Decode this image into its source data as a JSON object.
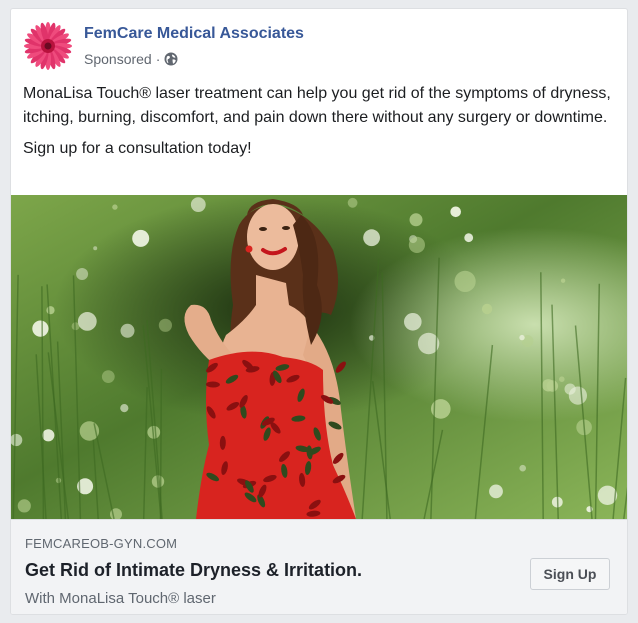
{
  "post": {
    "page_name": "FemCare Medical Associates",
    "sponsored_label": "Sponsored",
    "separator": "·",
    "avatar_icon": "pink-gerbera-flower",
    "privacy_icon": "globe-icon",
    "body_paragraph": "MonaLisa Touch® laser treatment can help you get rid of the symptoms of dryness, itching, burning, discomfort, and pain down there without any surgery or downtime.",
    "body_cta": "Sign up for a consultation today!"
  },
  "link_preview": {
    "domain": "FEMCAREOB-GYN.COM",
    "headline": "Get Rid of Intimate Dryness & Irritation.",
    "description": "With MonaLisa Touch® laser",
    "button_label": "Sign Up"
  },
  "colors": {
    "page_name": "#385898",
    "muted_text": "#606770",
    "link_box_bg": "#f2f3f5",
    "dress_red": "#d8241f",
    "foliage_green": "#5f8a3a"
  }
}
